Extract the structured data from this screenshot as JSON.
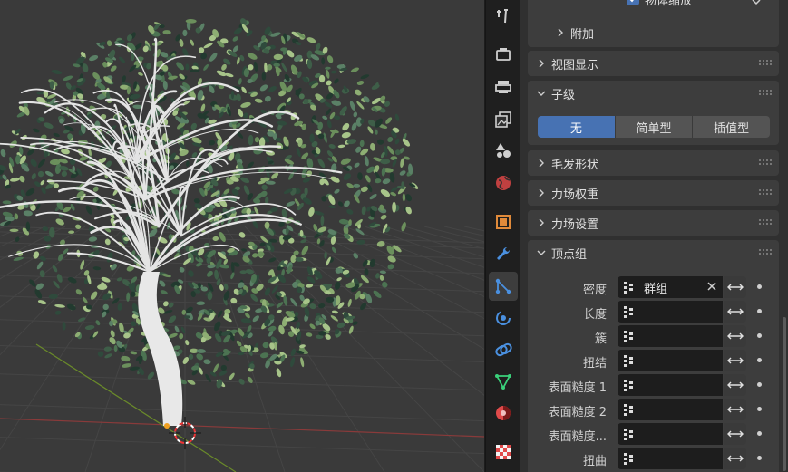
{
  "properties": {
    "top_partial": {
      "checkbox_label": "物体缩放"
    },
    "subpanel_fujia": "附加",
    "panels": {
      "viewport_display": "视图显示",
      "children": "子级",
      "hair_shape": "毛发形状",
      "field_weights": "力场权重",
      "force_field_settings": "力场设置",
      "vertex_groups": "顶点组"
    },
    "children_modes": [
      {
        "label": "无",
        "active": true
      },
      {
        "label": "简单型",
        "active": false
      },
      {
        "label": "插值型",
        "active": false
      }
    ],
    "vertex_group_rows": [
      {
        "label": "密度",
        "value": "群组"
      },
      {
        "label": "长度",
        "value": ""
      },
      {
        "label": "簇",
        "value": ""
      },
      {
        "label": "扭结",
        "value": ""
      },
      {
        "label": "表面糙度 1",
        "value": ""
      },
      {
        "label": "表面糙度 2",
        "value": ""
      },
      {
        "label": "表面糙度...",
        "value": ""
      },
      {
        "label": "扭曲",
        "value": ""
      }
    ]
  },
  "tabs": [
    {
      "name": "tool-tab-icon"
    },
    {
      "name": "render-tab-icon"
    },
    {
      "name": "output-tab-icon"
    },
    {
      "name": "view-layer-tab-icon"
    },
    {
      "name": "scene-tab-icon"
    },
    {
      "name": "world-tab-icon"
    },
    {
      "name": "object-tab-icon"
    },
    {
      "name": "modifier-tab-icon"
    },
    {
      "name": "particles-tab-icon",
      "active": true
    },
    {
      "name": "physics-tab-icon"
    },
    {
      "name": "constraints-tab-icon"
    },
    {
      "name": "data-tab-icon"
    },
    {
      "name": "material-tab-icon"
    },
    {
      "name": "texture-tab-icon"
    }
  ],
  "colors": {
    "accent": "#4772b3",
    "panel_bg": "#3d3d3d",
    "editor_bg": "#303030",
    "viewport_bg": "#3a3a3a"
  }
}
